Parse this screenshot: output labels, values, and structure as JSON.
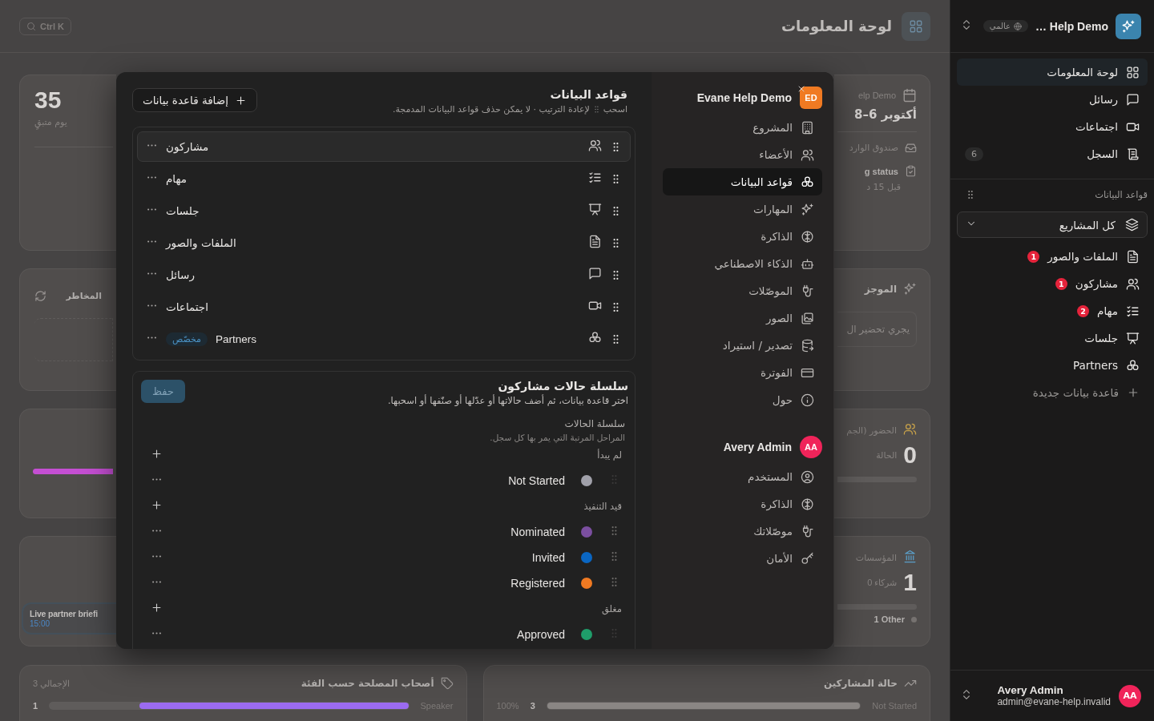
{
  "dashboard": {
    "title": "لوحة المعلومات",
    "search_shortcut": "Ctrl K",
    "countdown": {
      "value": "35",
      "label": "يوم متبقٍ"
    },
    "risks": {
      "title": "المخاطر"
    },
    "live_session": {
      "title": "Live partner briefi",
      "time": "15:00"
    },
    "event": {
      "name": "elp Demo",
      "dates": "أكتوبر 6–8",
      "inbox": "صندوق الوارد",
      "status_item": "g status",
      "status_time": "قبل 15 د"
    },
    "brief": {
      "title": "الموجز",
      "text": "يجري تحضير ال"
    },
    "attendance": {
      "title": "الحضور (الجم",
      "value": "0",
      "label": "الحالة"
    },
    "organizations": {
      "title": "المؤسسات",
      "value": "1",
      "label": "0 شركاء",
      "legend": "1 Other"
    },
    "stakeholders": {
      "title": "أصحاب المصلحة حسب الفئة",
      "total": "3 الإجمالي",
      "rows": [
        {
          "label": "Speaker",
          "count": "1",
          "level": 0.75
        }
      ]
    },
    "participant_status": {
      "title": "حالة المشاركين",
      "rows": [
        {
          "label": "Not Started",
          "count": "3",
          "percent": "100%",
          "level": 1
        }
      ]
    }
  },
  "modal": {
    "workspace": {
      "initials": "ED",
      "name": "Evane Help Demo"
    },
    "workspace_items": [
      {
        "label": "المشروع",
        "selected": false
      },
      {
        "label": "الأعضاء",
        "selected": false
      },
      {
        "label": "قواعد البيانات",
        "selected": true
      },
      {
        "label": "المهارات",
        "selected": false
      },
      {
        "label": "الذاكرة",
        "selected": false
      },
      {
        "label": "الذكاء الاصطناعي",
        "selected": false
      },
      {
        "label": "الموصّلات",
        "selected": false
      },
      {
        "label": "الصور",
        "selected": false
      },
      {
        "label": "تصدير / استيراد",
        "selected": false
      },
      {
        "label": "الفوترة",
        "selected": false
      },
      {
        "label": "حول",
        "selected": false
      }
    ],
    "user": {
      "initials": "AA",
      "name": "Avery Admin"
    },
    "user_items": [
      {
        "label": "المستخدم",
        "selected": false
      },
      {
        "label": "الذاكرة",
        "selected": false
      },
      {
        "label": "موصّلاتك",
        "selected": false
      },
      {
        "label": "الأمان",
        "selected": false
      }
    ],
    "databases": {
      "title": "قواعد البيانات",
      "hint_drag": "اسحب",
      "hint_rest": "لإعادة الترتيب · لا يمكن حذف قواعد البيانات المدمجة.",
      "add_button": "إضافة قاعدة بيانات",
      "items": [
        {
          "name": "مشاركون",
          "selected": true
        },
        {
          "name": "مهام",
          "selected": false
        },
        {
          "name": "جلسات",
          "selected": false
        },
        {
          "name": "الملفات والصور",
          "selected": false
        },
        {
          "name": "رسائل",
          "selected": false
        },
        {
          "name": "اجتماعات",
          "selected": false
        },
        {
          "name": "Partners",
          "badge": "مخصّص",
          "selected": false
        }
      ]
    },
    "status_flow": {
      "title": "سلسلة حالات مشاركون",
      "description": "اختر قاعدة بيانات، ثم أضف حالاتها أو عدّلها أو صنّفها أو اسحبها.",
      "save_button": {
        "label": "حفظ",
        "disabled": true
      },
      "section_label": "سلسلة الحالات",
      "section_hint": "المراحل المرتبة التي يمر بها كل سجل.",
      "groups": [
        {
          "label": "لم يبدأ",
          "statuses": [
            {
              "name": "Not Started",
              "color": "#a1a1aa",
              "draggable": false
            }
          ]
        },
        {
          "label": "قيد التنفيذ",
          "statuses": [
            {
              "name": "Nominated",
              "color": "#7b4fa0",
              "draggable": true
            },
            {
              "name": "Invited",
              "color": "#0a66c2",
              "draggable": true
            },
            {
              "name": "Registered",
              "color": "#f07a22",
              "draggable": true
            }
          ]
        },
        {
          "label": "مغلق",
          "statuses": [
            {
              "name": "Approved",
              "color": "#1f9d6a",
              "draggable": false
            }
          ]
        }
      ]
    }
  },
  "sidebar": {
    "workspace_name": "… Help Demo",
    "scope_badge": "عالمي",
    "nav": [
      {
        "label": "لوحة المعلومات",
        "selected": true
      },
      {
        "label": "رسائل",
        "selected": false
      },
      {
        "label": "اجتماعات",
        "selected": false
      },
      {
        "label": "السجل",
        "selected": false,
        "count": "6"
      }
    ],
    "databases_label": "قواعد البيانات",
    "project_filter": "كل المشاريع",
    "databases": [
      {
        "label": "الملفات والصور",
        "badge": "1"
      },
      {
        "label": "مشاركون",
        "badge": "1"
      },
      {
        "label": "مهام",
        "badge": "2"
      },
      {
        "label": "جلسات"
      },
      {
        "label": "Partners"
      }
    ],
    "new_database": "قاعدة بيانات جديدة",
    "user": {
      "initials": "AA",
      "name": "Avery Admin",
      "email": "admin@evane-help.invalid"
    }
  }
}
